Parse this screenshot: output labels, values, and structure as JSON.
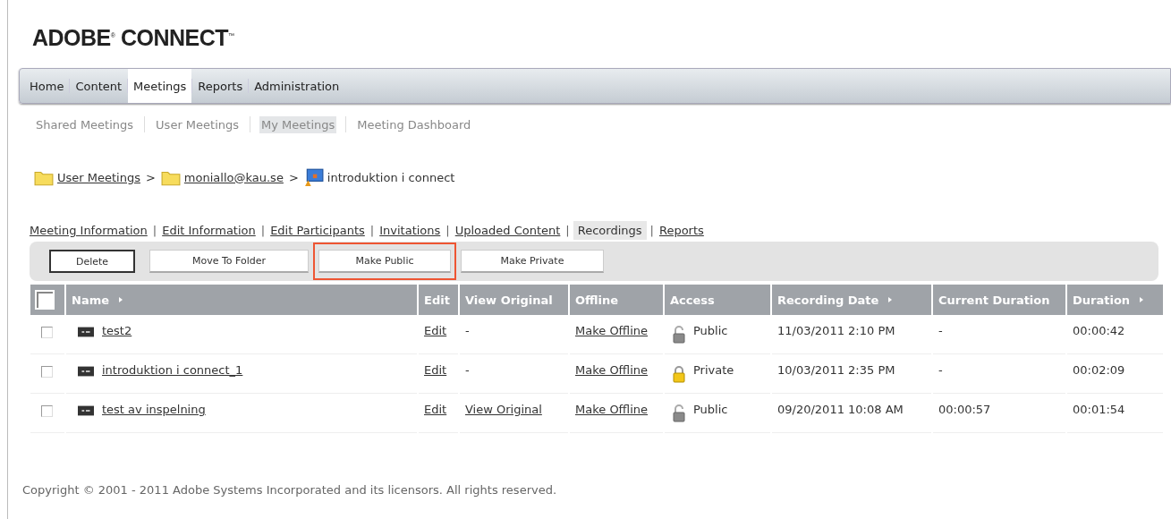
{
  "logo": "ADOBE$^{®}$ CONNECT$^{™}$",
  "nav": [
    {
      "label": "Home",
      "selected": false
    },
    {
      "label": "Content",
      "selected": false
    },
    {
      "label": "Meetings",
      "selected": true
    },
    {
      "label": "Reports",
      "selected": false
    },
    {
      "label": "Administration",
      "selected": false
    }
  ],
  "subnav": [
    {
      "label": "Shared Meetings",
      "selected": false
    },
    {
      "label": "User Meetings",
      "selected": false
    },
    {
      "label": "My Meetings",
      "selected": true
    },
    {
      "label": "Meeting Dashboard",
      "selected": false
    }
  ],
  "breadcrumb": [
    {
      "label": "User Meetings",
      "kind": "folder",
      "link": true
    },
    {
      "label": "moniallo@kau.se",
      "kind": "folder",
      "link": true
    },
    {
      "label": "introduktion i connect",
      "kind": "meeting",
      "link": false
    }
  ],
  "breadcrumb_separator": ">",
  "tabs": [
    {
      "label": "Meeting Information",
      "selected": false
    },
    {
      "label": "Edit Information",
      "selected": false
    },
    {
      "label": "Edit Participants",
      "selected": false
    },
    {
      "label": "Invitations",
      "selected": false
    },
    {
      "label": "Uploaded Content",
      "selected": false
    },
    {
      "label": "Recordings",
      "selected": true
    },
    {
      "label": "Reports",
      "selected": false
    }
  ],
  "tab_separator": "|",
  "toolbar": [
    {
      "label": "Delete",
      "focused": true,
      "highlighted": false
    },
    {
      "label": "Move To Folder",
      "focused": false,
      "highlighted": false
    },
    {
      "label": "Make Public",
      "focused": false,
      "highlighted": true
    },
    {
      "label": "Make Private",
      "focused": false,
      "highlighted": false
    }
  ],
  "table": {
    "select_all_checked": false,
    "columns": [
      {
        "label": "Name",
        "sortable": true
      },
      {
        "label": "Edit",
        "sortable": false
      },
      {
        "label": "View Original",
        "sortable": false
      },
      {
        "label": "Offline",
        "sortable": false
      },
      {
        "label": "Access",
        "sortable": false
      },
      {
        "label": "Recording Date",
        "sortable": true
      },
      {
        "label": "Current Duration",
        "sortable": false
      },
      {
        "label": "Duration",
        "sortable": true
      }
    ],
    "rows": [
      {
        "checked": false,
        "name": "test2",
        "edit": "Edit",
        "view_original": "-",
        "view_original_link": false,
        "offline": "Make Offline",
        "locked": false,
        "access": "Public",
        "recording_date": "11/03/2011 2:10 PM",
        "current_duration": "-",
        "duration": "00:00:42"
      },
      {
        "checked": false,
        "name": "introduktion i connect_1",
        "edit": "Edit",
        "view_original": "-",
        "view_original_link": false,
        "offline": "Make Offline",
        "locked": true,
        "access": "Private",
        "recording_date": "10/03/2011 2:35 PM",
        "current_duration": "-",
        "duration": "00:02:09"
      },
      {
        "checked": false,
        "name": "test av inspelning",
        "edit": "Edit",
        "view_original": "View Original",
        "view_original_link": true,
        "offline": "Make Offline",
        "locked": false,
        "access": "Public",
        "recording_date": "09/20/2011 10:08 AM",
        "current_duration": "00:00:57",
        "duration": "00:01:54"
      }
    ]
  },
  "footer": "Copyright © 2001 - 2011 Adobe Systems Incorporated and its licensors. All rights reserved."
}
